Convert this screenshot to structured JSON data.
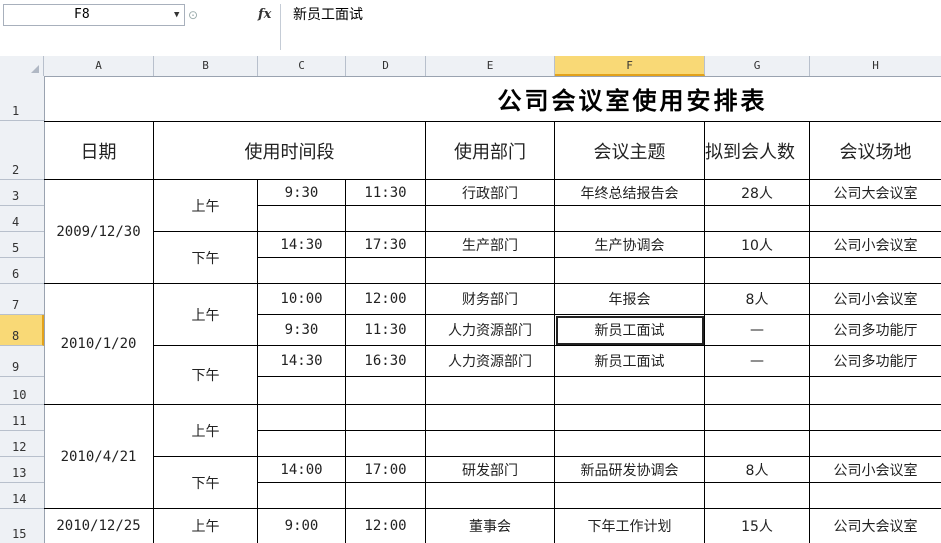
{
  "name_box": "F8",
  "formula": "新员工面试",
  "columns": [
    "A",
    "B",
    "C",
    "D",
    "E",
    "F",
    "G",
    "H"
  ],
  "selected_column": "F",
  "rows": [
    "1",
    "2",
    "3",
    "4",
    "5",
    "6",
    "7",
    "8",
    "9",
    "10",
    "11",
    "12",
    "13",
    "14",
    "15"
  ],
  "selected_row": "8",
  "title": "公司会议室使用安排表",
  "headers": {
    "date": "日期",
    "time": "使用时间段",
    "dept": "使用部门",
    "topic": "会议主题",
    "attendees": "拟到会人数",
    "venue": "会议场地"
  },
  "dates": [
    "2009/12/30",
    "2010/1/20",
    "2010/4/21",
    "2010/12/25"
  ],
  "periods": {
    "am": "上午",
    "pm": "下午"
  },
  "bookings": {
    "r3": {
      "start": "9:30",
      "end": "11:30",
      "dept": "行政部门",
      "topic": "年终总结报告会",
      "people": "28人",
      "venue": "公司大会议室"
    },
    "r5": {
      "start": "14:30",
      "end": "17:30",
      "dept": "生产部门",
      "topic": "生产协调会",
      "people": "10人",
      "venue": "公司小会议室"
    },
    "r7": {
      "start": "10:00",
      "end": "12:00",
      "dept": "财务部门",
      "topic": "年报会",
      "people": "8人",
      "venue": "公司小会议室"
    },
    "r8": {
      "start": "9:30",
      "end": "11:30",
      "dept": "人力资源部门",
      "topic": "新员工面试",
      "people": "—",
      "venue": "公司多功能厅"
    },
    "r9": {
      "start": "14:30",
      "end": "16:30",
      "dept": "人力资源部门",
      "topic": "新员工面试",
      "people": "—",
      "venue": "公司多功能厅"
    },
    "r13": {
      "start": "14:00",
      "end": "17:00",
      "dept": "研发部门",
      "topic": "新品研发协调会",
      "people": "8人",
      "venue": "公司小会议室"
    },
    "r15": {
      "start": "9:00",
      "end": "12:00",
      "dept": "董事会",
      "topic": "下年工作计划",
      "people": "15人",
      "venue": "公司大会议室"
    }
  }
}
